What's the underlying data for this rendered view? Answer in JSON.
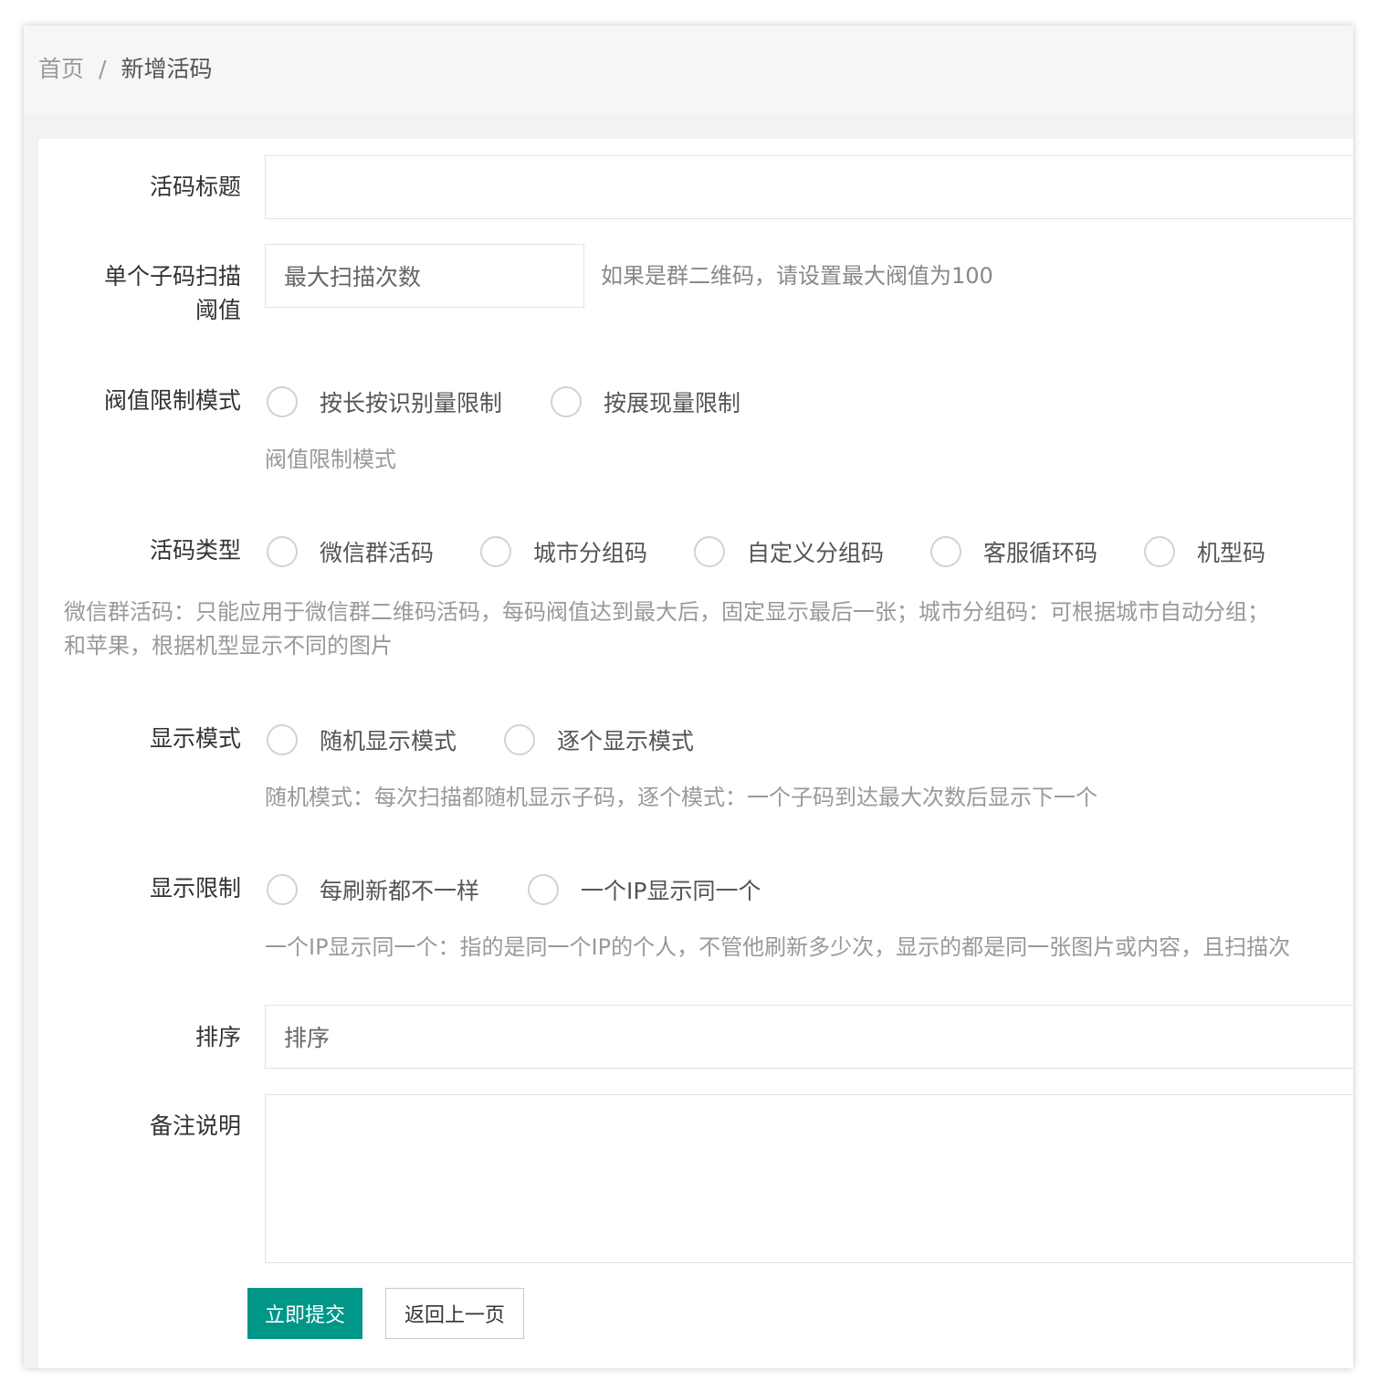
{
  "breadcrumb": {
    "home": "首页",
    "separator": "/",
    "current": "新增活码"
  },
  "form": {
    "title": {
      "label": "活码标题",
      "value": "",
      "placeholder": ""
    },
    "threshold": {
      "label_line1": "单个子码扫描",
      "label_line2": "阈值",
      "placeholder": "最大扫描次数",
      "help": "如果是群二维码，请设置最大阀值为100"
    },
    "limit_mode": {
      "label": "阀值限制模式",
      "options": [
        "按长按识别量限制",
        "按展现量限制"
      ],
      "help": "阀值限制模式"
    },
    "code_type": {
      "label": "活码类型",
      "options": [
        "微信群活码",
        "城市分组码",
        "自定义分组码",
        "客服循环码",
        "机型码"
      ],
      "desc_line1": "微信群活码：只能应用于微信群二维码活码，每码阀值达到最大后，固定显示最后一张；城市分组码：可根据城市自动分组；",
      "desc_line2": "和苹果，根据机型显示不同的图片"
    },
    "display_mode": {
      "label": "显示模式",
      "options": [
        "随机显示模式",
        "逐个显示模式"
      ],
      "help": "随机模式：每次扫描都随机显示子码，逐个模式：一个子码到达最大次数后显示下一个"
    },
    "display_limit": {
      "label": "显示限制",
      "options": [
        "每刷新都不一样",
        "一个IP显示同一个"
      ],
      "help": "一个IP显示同一个：指的是同一个IP的个人，不管他刷新多少次，显示的都是同一张图片或内容，且扫描次"
    },
    "sort": {
      "label": "排序",
      "placeholder": "排序"
    },
    "remark": {
      "label": "备注说明",
      "value": ""
    },
    "buttons": {
      "submit": "立即提交",
      "back": "返回上一页"
    }
  },
  "colors": {
    "primary": "#009688",
    "radio_border": "#d2d2d2",
    "help_text": "#999999"
  }
}
